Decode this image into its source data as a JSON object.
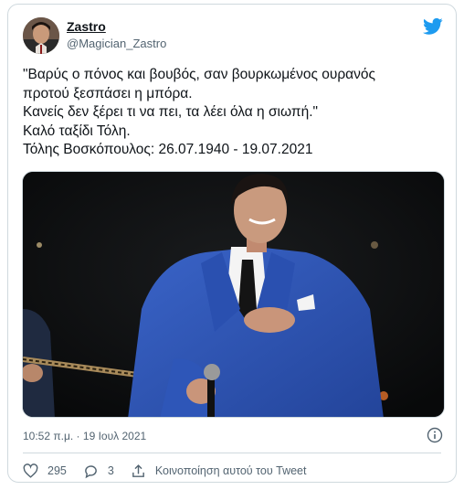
{
  "tweet": {
    "author_name": "Zastro",
    "author_handle": "@Magician_Zastro",
    "text_lines": [
      "\"Βαρύς ο πόνος και βουβός, σαν βουρκωμένος ουρανός",
      "προτού ξεσπάσει η μπόρα.",
      "Κανείς δεν ξέρει τι να πει, τα λέει όλα η σιωπή.\"",
      "Καλό ταξίδι Τόλη.",
      "Τόλης Βοσκόπουλος: 26.07.1940 - 19.07.2021"
    ],
    "timestamp": "10:52 π.μ. · 19 Ιουλ 2021",
    "likes": "295",
    "replies": "3",
    "share_label": "Κοινοποίηση αυτού του Tweet"
  },
  "colors": {
    "twitter_blue": "#1d9bf0",
    "text_primary": "#0f1419",
    "text_secondary": "#536471",
    "border": "#cfd9de",
    "suit_blue": "#2f56b8"
  },
  "icons": [
    "twitter-bird-icon",
    "info-icon",
    "heart-icon",
    "reply-icon",
    "share-icon"
  ]
}
